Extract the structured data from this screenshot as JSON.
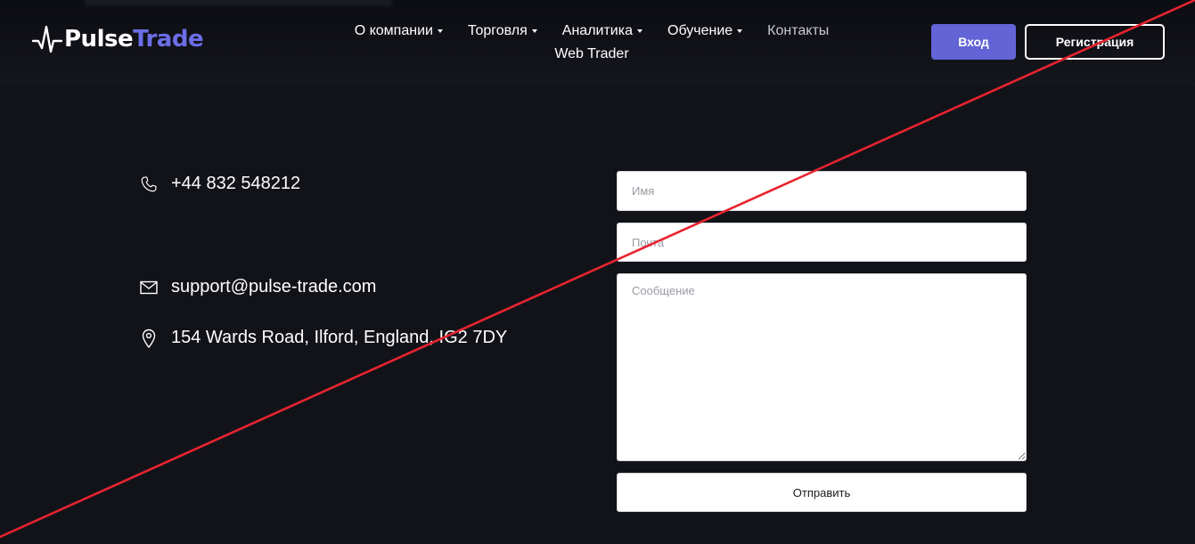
{
  "brand": {
    "name_part1": "Pulse",
    "name_part2": "Trade",
    "accent_color": "#6c6ee8"
  },
  "nav": {
    "items": [
      {
        "label": "О компании",
        "has_dropdown": true
      },
      {
        "label": "Торговля",
        "has_dropdown": true
      },
      {
        "label": "Аналитика",
        "has_dropdown": true
      },
      {
        "label": "Обучение",
        "has_dropdown": true
      },
      {
        "label": "Контакты",
        "has_dropdown": false
      },
      {
        "label": "Web Trader",
        "has_dropdown": false
      }
    ]
  },
  "header_buttons": {
    "login_label": "Вход",
    "register_label": "Регистрация",
    "login_color": "#6364d6"
  },
  "contacts": {
    "phone": {
      "icon": "phone-icon",
      "text": "+44 832 548212"
    },
    "email": {
      "icon": "mail-icon",
      "text": "support@pulse-trade.com"
    },
    "address": {
      "icon": "location-pin-icon",
      "text": "154 Wards Road, Ilford, England, IG2 7DY"
    }
  },
  "form": {
    "name_placeholder": "Имя",
    "email_placeholder": "Почта",
    "message_placeholder": "Сообщение",
    "submit_label": "Отправить"
  },
  "overlay": {
    "strike_color": "#e8232f"
  }
}
